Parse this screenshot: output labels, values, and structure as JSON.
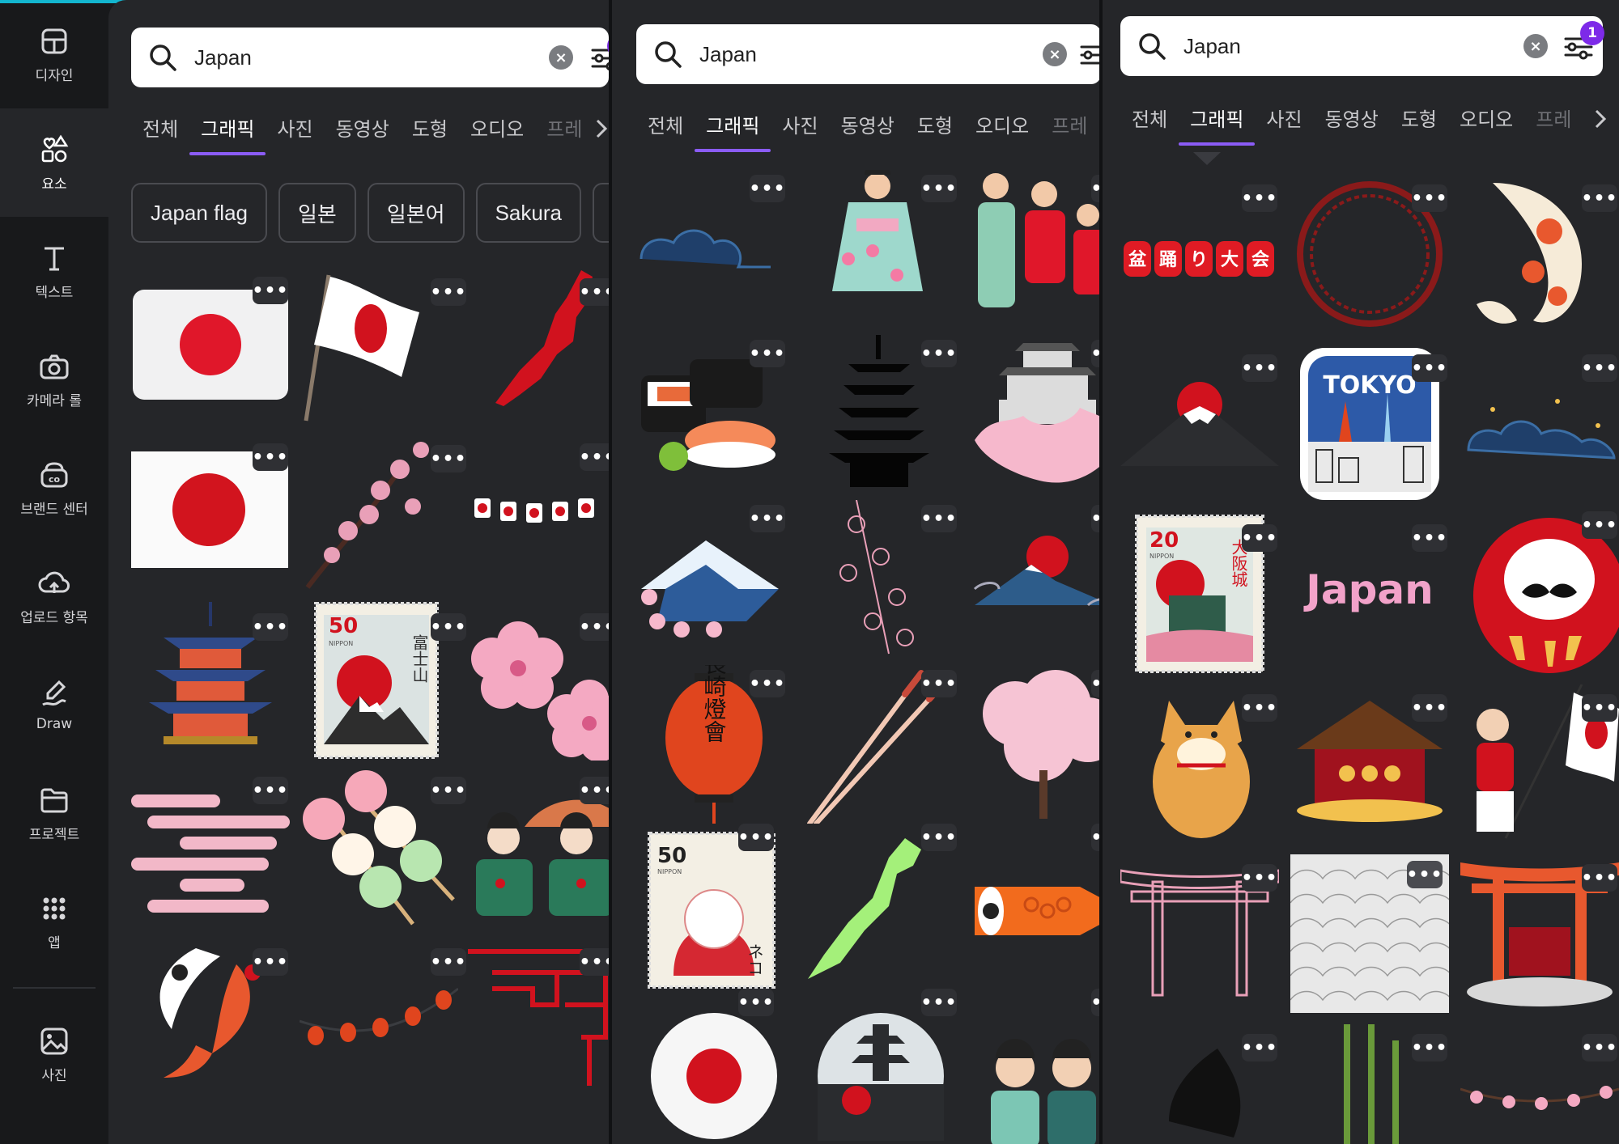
{
  "rail": {
    "items": [
      {
        "label": "디자인",
        "icon": "layout-icon"
      },
      {
        "label": "요소",
        "icon": "shapes-icon",
        "active": true
      },
      {
        "label": "텍스트",
        "icon": "text-icon"
      },
      {
        "label": "카메라 롤",
        "icon": "camera-icon"
      },
      {
        "label": "브랜드 센터",
        "icon": "brand-icon"
      },
      {
        "label": "업로드 항목",
        "icon": "upload-cloud-icon"
      },
      {
        "label": "Draw",
        "icon": "draw-icon"
      },
      {
        "label": "프로젝트",
        "icon": "folder-icon"
      },
      {
        "label": "앱",
        "icon": "apps-grid-icon"
      },
      {
        "label": "사진",
        "icon": "photo-icon"
      }
    ]
  },
  "search": {
    "query": "Japan",
    "filter_count": "1"
  },
  "tabs": [
    "전체",
    "그래픽",
    "사진",
    "동영상",
    "도형",
    "오디오",
    "프레"
  ],
  "active_tab": "그래픽",
  "chips": [
    "Japan flag",
    "일본",
    "일본어",
    "Sakura"
  ],
  "more_label": "•••",
  "panel2_results": [
    "clouds",
    "kimono-girl",
    "kimono-family",
    "sushi",
    "pagoda-silhouette",
    "himeji-castle",
    "mount-fuji-sakura",
    "sakura-line",
    "fuji-sunrise",
    "nagasaki-lantern",
    "chopsticks",
    "sakura-tree",
    "lucky-cat-stamp",
    "japan-map-green",
    "koinobori",
    "flag-circle",
    "pagoda-circle",
    "kimono-couple"
  ],
  "panel3_texts": {
    "lantern_chars": [
      "盆",
      "踊",
      "り",
      "大",
      "会"
    ],
    "tokyo": "TOKYO",
    "stamp_num": "20",
    "stamp_nippon": "NIPPON",
    "stamp_chars": "大阪城",
    "japan_word": "Japan"
  },
  "panel1_texts": {
    "stamp_num": "50",
    "stamp_nippon": "NIPPON",
    "stamp_chars": "富士山"
  },
  "panel2_texts": {
    "lantern_chars": "長崎燈會",
    "stamp_num": "50",
    "stamp_nippon": "NIPPON",
    "stamp_chars": "ネコ"
  },
  "colors": {
    "accent": "#8b5cf6",
    "badge": "#7d2ae8",
    "topbar": "#13b6cf",
    "flag_red": "#e0172a"
  }
}
